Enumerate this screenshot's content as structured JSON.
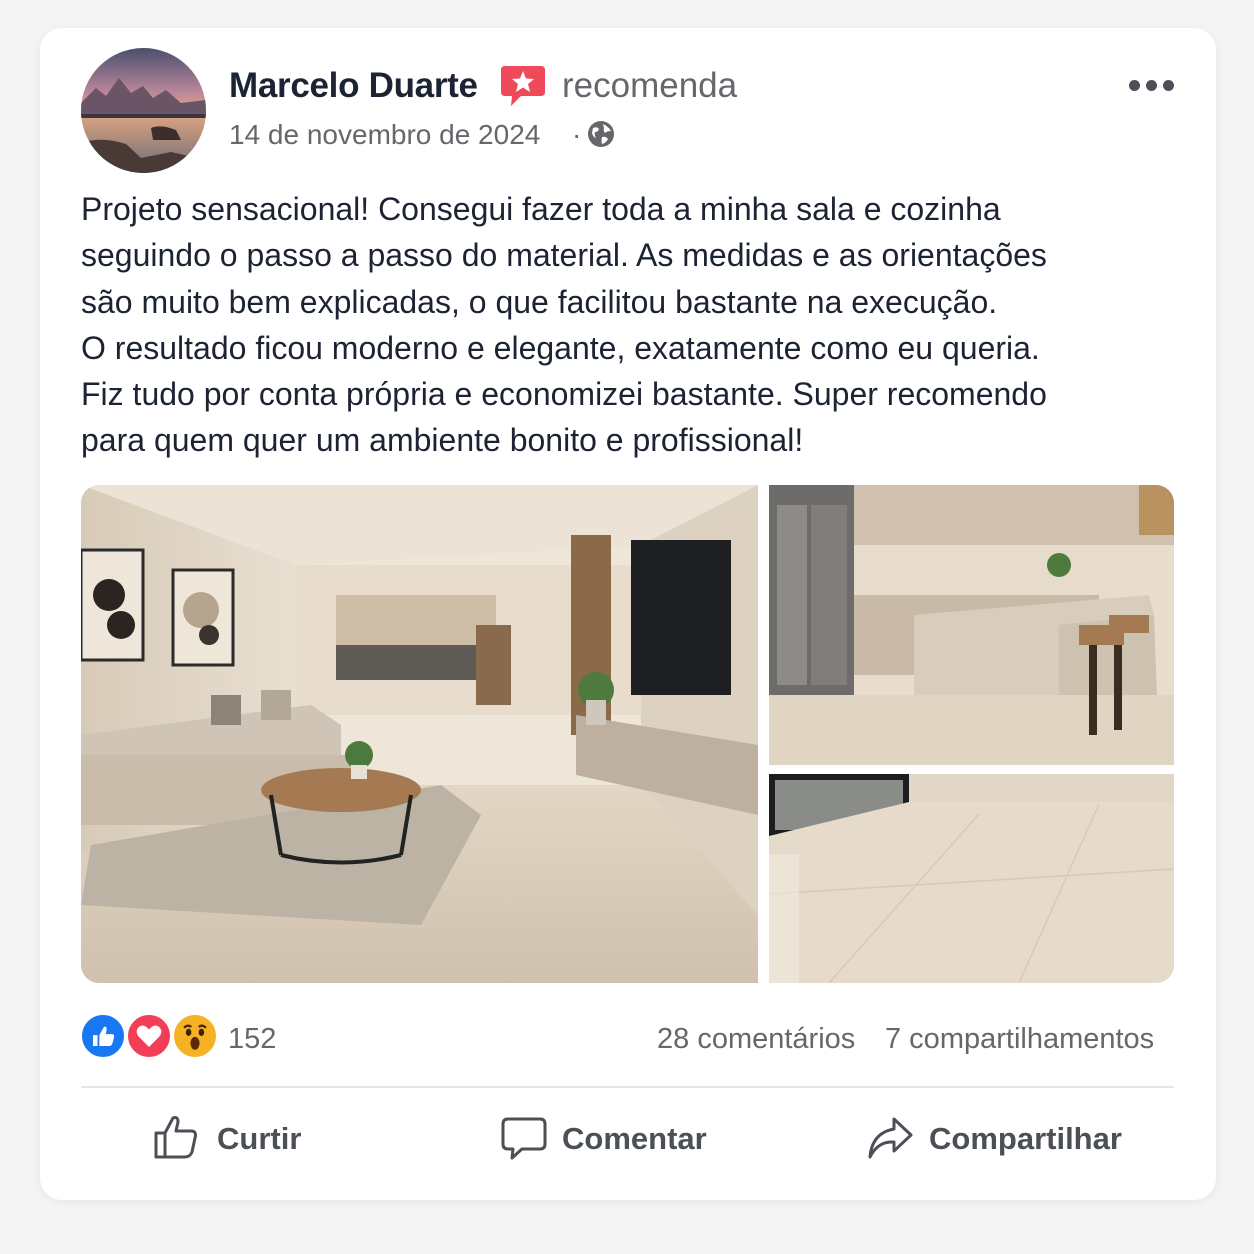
{
  "post": {
    "author": "Marcelo Duarte",
    "action": "recomenda",
    "date": "14 de novembro de 2024",
    "separator": "·",
    "audience_icon": "globe-icon",
    "badge_icon": "recommend-star-icon",
    "more_icon": "more-options-icon",
    "text_lines": [
      "Projeto sensacional! Consegui fazer toda a minha sala e cozinha",
      "seguindo o passo a passo do material. As medidas e as orientações",
      "são muito bem explicadas, o que facilitou bastante na execução.",
      "O resultado ficou moderno e elegante, exatamente como eu queria.",
      "Fiz tudo por conta própria e economizei bastante. Super recomendo",
      "para quem quer um ambiente bonito e profissional!"
    ]
  },
  "photos": [
    "living-room-photo",
    "kitchen-photo",
    "floor-photo"
  ],
  "engagement": {
    "reaction_icons": [
      "like-reaction-icon",
      "love-reaction-icon",
      "wow-reaction-icon"
    ],
    "reactions_count": "152",
    "comments": "28 comentários",
    "shares": "7 compartilhamentos"
  },
  "actions": {
    "like": "Curtir",
    "comment": "Comentar",
    "share": "Compartilhar"
  },
  "colors": {
    "like_blue": "#1877f2",
    "love_red": "#f33e58",
    "wow_yellow": "#f7b125",
    "badge_red": "#ef4a5a",
    "text_dark": "#1c2333",
    "text_muted": "#65676b"
  }
}
